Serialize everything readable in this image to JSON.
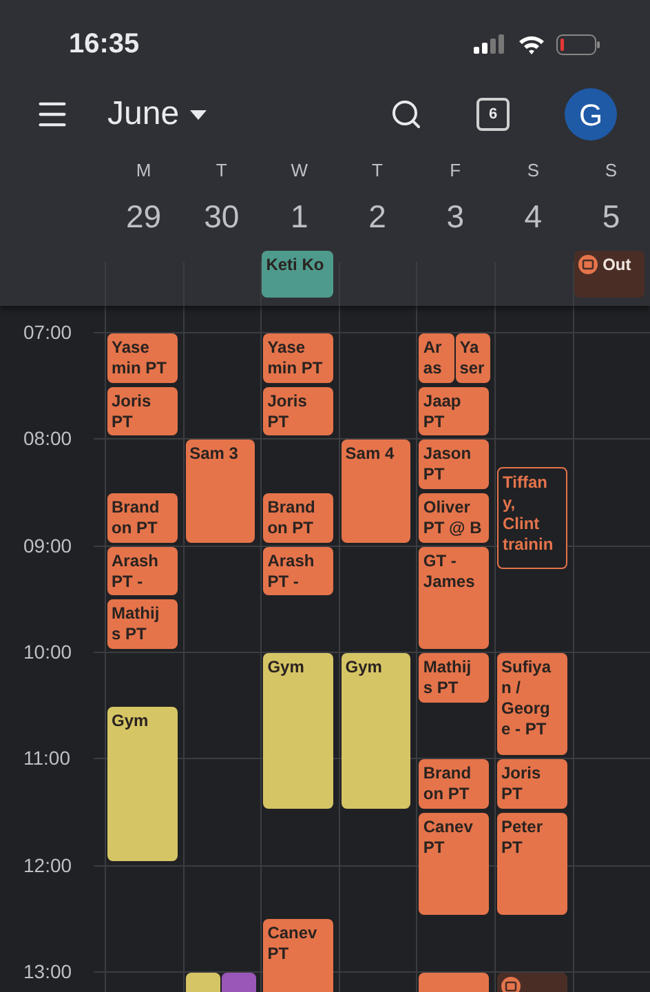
{
  "status_bar": {
    "time": "16:35"
  },
  "toolbar": {
    "month": "June",
    "today_badge": "6",
    "avatar": "G"
  },
  "days": [
    {
      "weekday": "M",
      "date": "29"
    },
    {
      "weekday": "T",
      "date": "30"
    },
    {
      "weekday": "W",
      "date": "1"
    },
    {
      "weekday": "T",
      "date": "2"
    },
    {
      "weekday": "F",
      "date": "3"
    },
    {
      "weekday": "S",
      "date": "4"
    },
    {
      "weekday": "S",
      "date": "5"
    }
  ],
  "all_day": [
    {
      "kind": "event",
      "color": "#4e9a8c",
      "lines": [
        "Keti Ko"
      ]
    },
    {
      "kind": "out",
      "color": "#4a2e26",
      "lines": [
        "Out"
      ]
    }
  ],
  "hours": [
    "07:00",
    "08:00",
    "09:00",
    "10:00",
    "11:00",
    "12:00",
    "13:00"
  ],
  "events": [
    {
      "kind": "event",
      "color": "#e5744b",
      "lines": [
        "Yase",
        "min PT"
      ]
    },
    {
      "kind": "event",
      "color": "#e5744b",
      "lines": [
        "Joris",
        "PT"
      ]
    },
    {
      "kind": "event",
      "color": "#e5744b",
      "lines": [
        "Brand",
        "on PT"
      ]
    },
    {
      "kind": "event",
      "color": "#e5744b",
      "lines": [
        "Arash",
        "PT -"
      ]
    },
    {
      "kind": "event",
      "color": "#e5744b",
      "lines": [
        "Mathij",
        "s PT"
      ]
    },
    {
      "kind": "event",
      "color": "#d6c565",
      "lines": [
        "Gym"
      ]
    },
    {
      "kind": "event",
      "color": "#e5744b",
      "lines": [
        "Sam 3"
      ]
    },
    {
      "kind": "event",
      "color": "#d6c565"
    },
    {
      "kind": "event",
      "color": "#9a57b8"
    },
    {
      "kind": "event",
      "color": "#e5744b",
      "lines": [
        "Yase",
        "min PT"
      ]
    },
    {
      "kind": "event",
      "color": "#e5744b",
      "lines": [
        "Joris",
        "PT"
      ]
    },
    {
      "kind": "event",
      "color": "#e5744b",
      "lines": [
        "Brand",
        "on PT"
      ]
    },
    {
      "kind": "event",
      "color": "#e5744b",
      "lines": [
        "Arash",
        "PT -"
      ]
    },
    {
      "kind": "event",
      "color": "#d6c565",
      "lines": [
        "Gym"
      ]
    },
    {
      "kind": "event",
      "color": "#e5744b",
      "lines": [
        "Canev",
        "PT"
      ]
    },
    {
      "kind": "event",
      "color": "#e5744b",
      "lines": [
        "Sam 4"
      ]
    },
    {
      "kind": "event",
      "color": "#d6c565",
      "lines": [
        "Gym"
      ]
    },
    {
      "kind": "event",
      "color": "#e5744b",
      "lines": [
        "Ar",
        "as"
      ]
    },
    {
      "kind": "event",
      "color": "#e5744b",
      "lines": [
        "Ya",
        "ser"
      ]
    },
    {
      "kind": "event",
      "color": "#e5744b",
      "lines": [
        "Jaap",
        "PT"
      ]
    },
    {
      "kind": "event",
      "color": "#e5744b",
      "lines": [
        "Jason",
        "PT"
      ]
    },
    {
      "kind": "event",
      "color": "#e5744b",
      "lines": [
        "Oliver",
        "PT @ B"
      ]
    },
    {
      "kind": "event",
      "color": "#e5744b",
      "lines": [
        "GT -",
        "James"
      ]
    },
    {
      "kind": "event",
      "color": "#e5744b",
      "lines": [
        "Mathij",
        "s PT"
      ]
    },
    {
      "kind": "event",
      "color": "#e5744b",
      "lines": [
        "Brand",
        "on PT"
      ]
    },
    {
      "kind": "event",
      "color": "#e5744b",
      "lines": [
        "Canev",
        "PT"
      ]
    },
    {
      "kind": "event",
      "color": "#e5744b"
    },
    {
      "kind": "outlined",
      "color": "#e5744b",
      "lines": [
        "Tiffan",
        "y,",
        "Clint",
        "trainin"
      ]
    },
    {
      "kind": "event",
      "color": "#e5744b",
      "lines": [
        "Sufiya",
        "n /",
        "Georg",
        "e - PT"
      ]
    },
    {
      "kind": "event",
      "color": "#e5744b",
      "lines": [
        "Joris",
        "PT"
      ]
    },
    {
      "kind": "event",
      "color": "#e5744b",
      "lines": [
        "Peter",
        "PT"
      ]
    },
    {
      "kind": "out",
      "color": "#4a2e26"
    }
  ]
}
